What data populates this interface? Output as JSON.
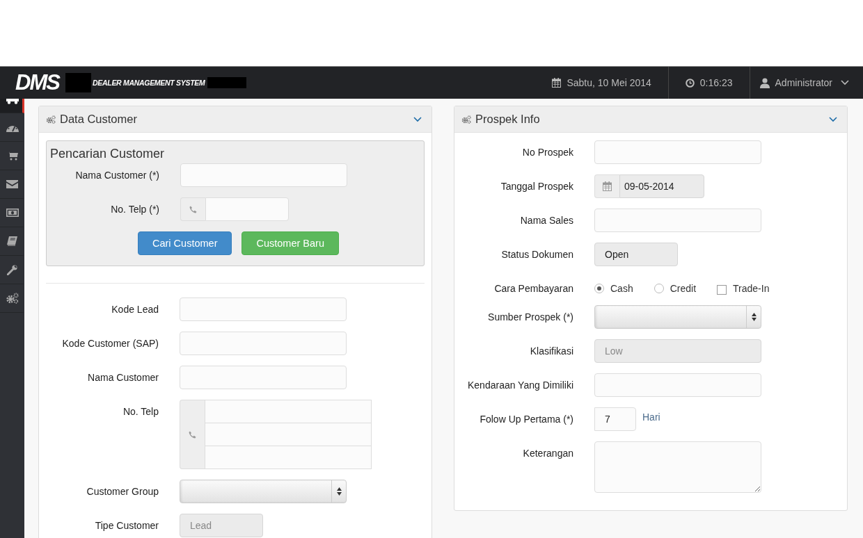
{
  "header": {
    "logo": "DMS",
    "system_name": "DEALER MANAGEMENT SYSTEM",
    "date": "Sabtu, 10 Mei 2014",
    "time": "0:16:23",
    "user": "Administrator"
  },
  "sidebar": {
    "items": [
      {
        "kind": "truck",
        "selected": true
      },
      {
        "kind": "gauge",
        "selected": false
      },
      {
        "kind": "cart",
        "selected": false
      },
      {
        "kind": "envelope",
        "selected": false
      },
      {
        "kind": "money",
        "selected": false
      },
      {
        "kind": "book",
        "selected": false
      },
      {
        "kind": "wrench",
        "selected": false
      },
      {
        "kind": "gears",
        "selected": false
      }
    ]
  },
  "data_customer": {
    "title": "Data Customer",
    "expanded": true,
    "search": {
      "title": "Pencarian Customer",
      "fields": [
        {
          "kind": "text",
          "label": "Nama Customer (*)",
          "readonly": false
        },
        {
          "kind": "phone",
          "label": "No. Telp (*)",
          "readonly": false
        }
      ],
      "buttons": [
        {
          "kind": "primary",
          "label": "Cari Customer"
        },
        {
          "kind": "success",
          "label": "Customer Baru"
        }
      ]
    },
    "fields": [
      {
        "kind": "text",
        "label": "Kode Lead",
        "readonly": false
      },
      {
        "kind": "text",
        "label": "Kode Customer (SAP)",
        "readonly": false
      },
      {
        "kind": "text",
        "label": "Nama Customer",
        "readonly": false
      },
      {
        "kind": "phone-multi",
        "label": "No. Telp",
        "readonly": false
      },
      {
        "kind": "select",
        "label": "Customer Group"
      },
      {
        "kind": "text-short",
        "label": "Tipe Customer",
        "placeholder": "Lead",
        "readonly": true
      }
    ]
  },
  "prospek_info": {
    "title": "Prospek Info",
    "expanded": true,
    "fields": [
      {
        "kind": "text",
        "label": "No Prospek",
        "readonly": false
      },
      {
        "kind": "date",
        "label": "Tanggal Prospek",
        "value": "09-05-2014",
        "readonly": true
      },
      {
        "kind": "text",
        "label": "Nama Sales",
        "readonly": false
      },
      {
        "kind": "text-short",
        "label": "Status Dokumen",
        "value": "Open",
        "readonly": true
      },
      {
        "kind": "choice",
        "label": "Cara Pembayaran",
        "options": [
          {
            "kind": "radio",
            "label": "Cash",
            "selected": true
          },
          {
            "kind": "radio",
            "label": "Credit",
            "selected": false
          },
          {
            "kind": "checkbox",
            "label": "Trade-In",
            "checked": false
          }
        ]
      },
      {
        "kind": "select",
        "label": "Sumber Prospek (*)"
      },
      {
        "kind": "text",
        "label": "Klasifikasi",
        "placeholder": "Low",
        "readonly": true
      },
      {
        "kind": "text",
        "label": "Kendaraan Yang Dimiliki",
        "readonly": false
      },
      {
        "kind": "number",
        "label": "Folow Up Pertama (*)",
        "value": "7",
        "suffix": "Hari",
        "readonly": false
      },
      {
        "kind": "textarea",
        "label": "Keterangan",
        "readonly": false
      }
    ]
  }
}
